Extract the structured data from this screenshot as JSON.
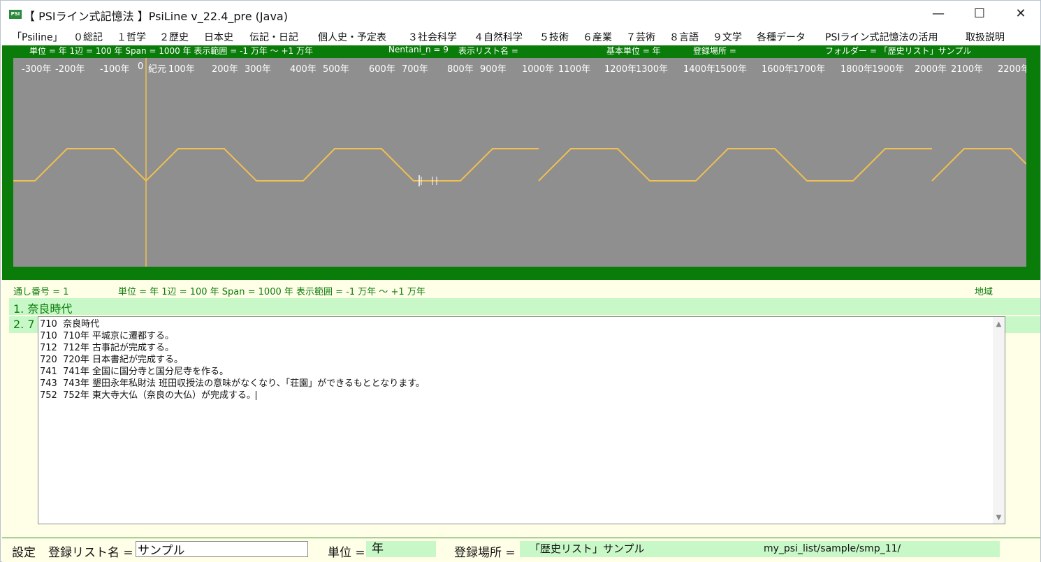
{
  "window": {
    "title": "【 PSIライン式記憶法 】PsiLine v_22.4_pre (Java)",
    "icon_text": "PSI",
    "controls": {
      "minimize": "—",
      "maximize": "☐",
      "close": "✕"
    }
  },
  "menu": [
    "「Psiline」",
    "０総記",
    "１哲学",
    "２歴史",
    "日本史",
    "伝記・日記",
    "個人史・予定表",
    "３社会科学",
    "４自然科学",
    "５技術",
    "６産業",
    "７芸術",
    "８言語",
    "９文学",
    "各種データ",
    "PSIライン式記憶法の活用",
    "取扱説明"
  ],
  "timeline_status": {
    "unit": "単位 = 年  1辺 = 100 年  Span = 1000 年  表示範囲 = -1 万年 ～ +1 万年",
    "nentani": "Nentani_n = 9",
    "list_name": "表示リスト名 =",
    "base_unit": "基本単位 = 年",
    "location": "登録場所 =",
    "folder": "フォルダー = 「歴史リスト」サンプル"
  },
  "axis_ticks": [
    "-300年",
    "-200年",
    "-100年",
    "0",
    "紀元",
    "100年",
    "200年",
    "300年",
    "400年",
    "500年",
    "600年",
    "700年",
    "800年",
    "900年",
    "1000年",
    "1100年",
    "1200年",
    "1300年",
    "1400年",
    "1500年",
    "1600年",
    "1700年",
    "1800年",
    "1900年",
    "2000年",
    "2100年",
    "2200年"
  ],
  "info_row": {
    "serial": "通し番号 = 1",
    "unit": "単位 = 年  1辺 = 100 年  Span = 1000 年  表示範囲 = -1 万年 ～ +1 万年",
    "region": "地域"
  },
  "list_rows": [
    {
      "label": "1. 奈良時代"
    },
    {
      "label": "2. 7"
    }
  ],
  "editor_lines": [
    "710  奈良時代",
    "710  710年 平城京に遷都する。",
    "712  712年 古事記が完成する。",
    "720  720年 日本書紀が完成する。",
    "741  741年 全国に国分寺と国分尼寺を作る。",
    "743  743年 墾田永年私財法 班田収授法の意味がなくなり、「荘園」ができるもととなります。",
    "752  752年 東大寺大仏（奈良の大仏）が完成する。"
  ],
  "bottom_bar": {
    "settings": "設定",
    "list_name_label": "登録リスト名 =",
    "list_name_value": "サンプル",
    "unit_label": "単位 =",
    "unit_value": "年",
    "location_label": "登録場所 =",
    "location_value": "「歴史リスト」サンプル",
    "path": "my_psi_list/sample/smp_11/"
  },
  "colors": {
    "panel_green": "#0a7c0a",
    "canvas_gray": "#8f8f8f",
    "line_yellow": "#f0c050",
    "row_green": "#c8f8c8"
  }
}
